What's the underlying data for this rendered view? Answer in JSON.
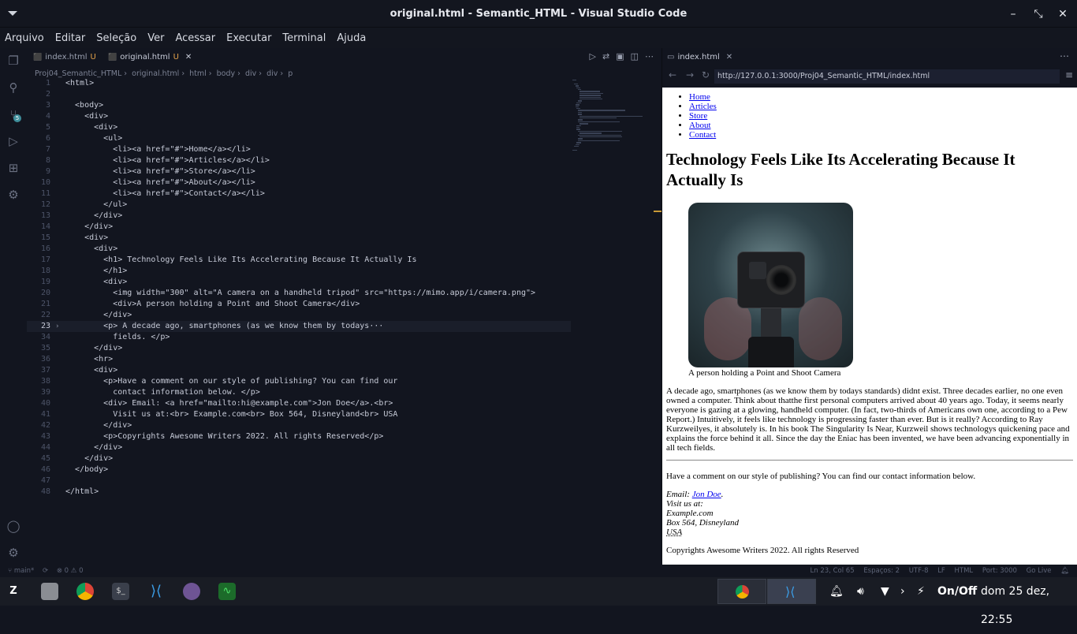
{
  "window": {
    "title": "original.html - Semantic_HTML - Visual Studio Code"
  },
  "menu": [
    "Arquivo",
    "Editar",
    "Seleção",
    "Ver",
    "Acessar",
    "Executar",
    "Terminal",
    "Ajuda"
  ],
  "tabs": [
    {
      "label": "index.html",
      "status": "U"
    },
    {
      "label": "original.html",
      "status": "U"
    }
  ],
  "breadcrumb": [
    "Proj04_Semantic_HTML",
    "original.html",
    "html",
    "body",
    "div",
    "div",
    "p"
  ],
  "scm_badge": "5",
  "code_lines": [
    {
      "n": "1",
      "t": "<html>"
    },
    {
      "n": "2",
      "t": ""
    },
    {
      "n": "3",
      "t": "  <body>"
    },
    {
      "n": "4",
      "t": "    <div>"
    },
    {
      "n": "5",
      "t": "      <div>"
    },
    {
      "n": "6",
      "t": "        <ul>"
    },
    {
      "n": "7",
      "t": "          <li><a href=\"#\">Home</a></li>"
    },
    {
      "n": "8",
      "t": "          <li><a href=\"#\">Articles</a></li>"
    },
    {
      "n": "9",
      "t": "          <li><a href=\"#\">Store</a></li>"
    },
    {
      "n": "10",
      "t": "          <li><a href=\"#\">About</a></li>"
    },
    {
      "n": "11",
      "t": "          <li><a href=\"#\">Contact</a></li>"
    },
    {
      "n": "12",
      "t": "        </ul>"
    },
    {
      "n": "13",
      "t": "      </div>"
    },
    {
      "n": "14",
      "t": "    </div>"
    },
    {
      "n": "15",
      "t": "    <div>"
    },
    {
      "n": "16",
      "t": "      <div>"
    },
    {
      "n": "17",
      "t": "        <h1> Technology Feels Like Its Accelerating Because It Actually Is"
    },
    {
      "n": "18",
      "t": "        </h1>"
    },
    {
      "n": "19",
      "t": "        <div>"
    },
    {
      "n": "20",
      "t": "          <img width=\"300\" alt=\"A camera on a handheld tripod\" src=\"https://mimo.app/i/camera.png\">"
    },
    {
      "n": "21",
      "t": "          <div>A person holding a Point and Shoot Camera</div>"
    },
    {
      "n": "22",
      "t": "        </div>"
    },
    {
      "n": "23",
      "t": "        <p> A decade ago, smartphones (as we know them by todays···"
    },
    {
      "n": "34",
      "t": "          fields. </p>"
    },
    {
      "n": "35",
      "t": "      </div>"
    },
    {
      "n": "36",
      "t": "      <hr>"
    },
    {
      "n": "37",
      "t": "      <div>"
    },
    {
      "n": "38",
      "t": "        <p>Have a comment on our style of publishing? You can find our"
    },
    {
      "n": "39",
      "t": "          contact information below. </p>"
    },
    {
      "n": "40",
      "t": "        <div> Email: <a href=\"mailto:hi@example.com\">Jon Doe</a>.<br>"
    },
    {
      "n": "41",
      "t": "          Visit us at:<br> Example.com<br> Box 564, Disneyland<br> USA"
    },
    {
      "n": "42",
      "t": "        </div>"
    },
    {
      "n": "43",
      "t": "        <p>Copyrights Awesome Writers 2022. All rights Reserved</p>"
    },
    {
      "n": "44",
      "t": "      </div>"
    },
    {
      "n": "45",
      "t": "    </div>"
    },
    {
      "n": "46",
      "t": "  </body>"
    },
    {
      "n": "47",
      "t": ""
    },
    {
      "n": "48",
      "t": "</html>"
    }
  ],
  "preview": {
    "tab": "index.html",
    "url": "http://127.0.0.1:3000/Proj04_Semantic_HTML/index.html",
    "nav": [
      "Home",
      "Articles",
      "Store",
      "About",
      "Contact"
    ],
    "heading": "Technology Feels Like Its Accelerating Because It Actually Is",
    "caption": "A person holding a Point and Shoot Camera",
    "paragraph": "A decade ago, smartphones (as we know them by todays standards) didnt exist. Three decades earlier, no one even owned a computer. Think about thatthe first personal computers arrived about 40 years ago. Today, it seems nearly everyone is gazing at a glowing, handheld computer. (In fact, two-thirds of Americans own one, according to a Pew Report.) Intuitively, it feels like technology is progressing faster than ever. But is it really? According to Ray Kurzweilyes, it absolutely is. In his book The Singularity Is Near, Kurzweil shows technologys quickening pace and explains the force behind it all. Since the day the Eniac has been invented, we have been advancing exponentially in all tech fields.",
    "comment": "Have a comment on our style of publishing? You can find our contact information below.",
    "email_label": "Email: ",
    "email_link": "Jon Doe",
    "visit": "Visit us at:",
    "site": "Example.com",
    "box": "Box 564, Disneyland",
    "country": "USA",
    "copyright": "Copyrights Awesome Writers 2022. All rights Reserved"
  },
  "status": {
    "branch": "main*",
    "problems": "⊗ 0 ⚠ 0",
    "position": "Ln 23, Col 65",
    "spaces": "Espaços: 2",
    "encoding": "UTF-8",
    "eol": "LF",
    "language": "HTML",
    "port": "Port: 3000",
    "golive": "Go Live"
  },
  "taskbar": {
    "onoff": "On/Off",
    "clock": "dom 25 dez, 22:55"
  }
}
